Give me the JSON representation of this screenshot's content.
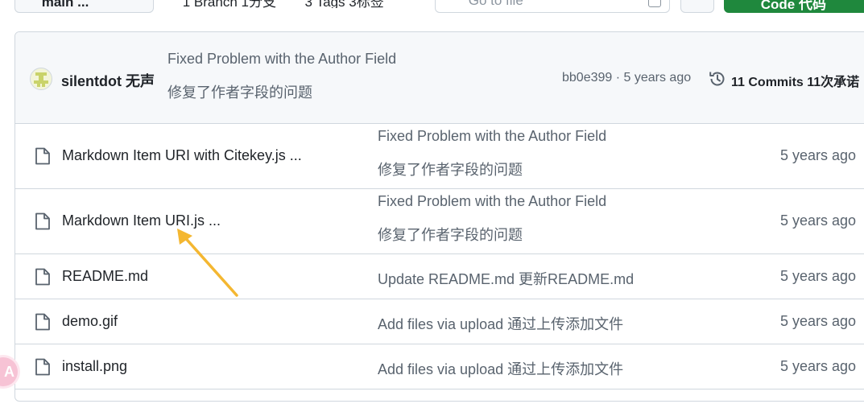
{
  "toolbar": {
    "branch_label": "main",
    "branch_info": "1 Branch 1分支",
    "tags_info": "3 Tags 3标签",
    "goto_placeholder": "Go to file",
    "code_label": "Code 代码"
  },
  "latest_commit": {
    "author": "silentdot 无声",
    "message_en": "Fixed Problem with the Author Field",
    "message_zh": "修复了作者字段的问题",
    "hash_age": "bb0e399 · 5 years ago",
    "commits_label": "11 Commits 11次承诺"
  },
  "files": [
    {
      "name": "Markdown Item URI with Citekey.js ...",
      "message_en": "Fixed Problem with the Author Field",
      "message_zh": "修复了作者字段的问题",
      "age": "5 years ago"
    },
    {
      "name": "Markdown Item URI.js ...",
      "message_en": "Fixed Problem with the Author Field",
      "message_zh": "修复了作者字段的问题",
      "age": "5 years ago"
    },
    {
      "name": "README.md",
      "message": "Update README.md 更新README.md",
      "age": "5 years ago"
    },
    {
      "name": "demo.gif",
      "message": "Add files via upload 通过上传添加文件",
      "age": "5 years ago"
    },
    {
      "name": "install.png",
      "message": "Add files via upload 通过上传添加文件",
      "age": "5 years ago"
    }
  ],
  "annotation": {
    "arrow_color": "#f4b731"
  },
  "side_widget": {
    "icon": "translate-icon",
    "label": "A"
  },
  "colors": {
    "code_button": "#1f883d",
    "border": "#d0d7de",
    "muted_text": "#59636e"
  }
}
